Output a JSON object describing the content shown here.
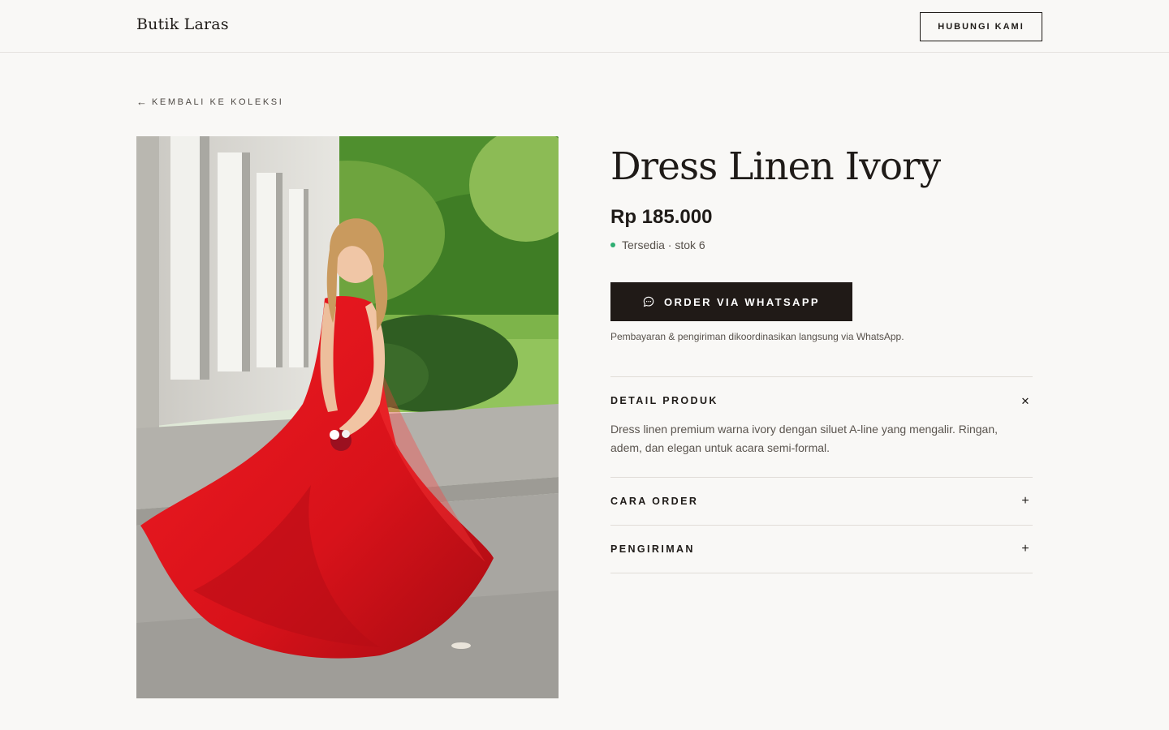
{
  "header": {
    "brand": "Butik Laras",
    "contact_label": "HUBUNGI KAMI"
  },
  "nav": {
    "back_label": "KEMBALI KE KOLEKSI",
    "back_arrow": "←"
  },
  "product": {
    "image_icon": "product-photo",
    "title": "Dress Linen Ivory",
    "price": "Rp 185.000",
    "stock_text": "Tersedia · stok 6",
    "stock_color": "#2fae72",
    "order_label": "ORDER VIA WHATSAPP",
    "order_icon": "chat-bubble-icon",
    "note": "Pembayaran & pengiriman dikoordinasikan langsung via WhatsApp."
  },
  "accordion": {
    "items": [
      {
        "title": "DETAIL PRODUK",
        "toggle": "✕",
        "expanded": true,
        "body": "Dress linen premium warna ivory dengan siluet A-line yang mengalir. Ringan, adem, dan elegan untuk acara semi-formal."
      },
      {
        "title": "CARA ORDER",
        "toggle": "+",
        "expanded": false
      },
      {
        "title": "PENGIRIMAN",
        "toggle": "+",
        "expanded": false
      }
    ]
  },
  "colors": {
    "background": "#f9f8f6",
    "primary_button": "#201a17",
    "dress": "#e0151d"
  }
}
